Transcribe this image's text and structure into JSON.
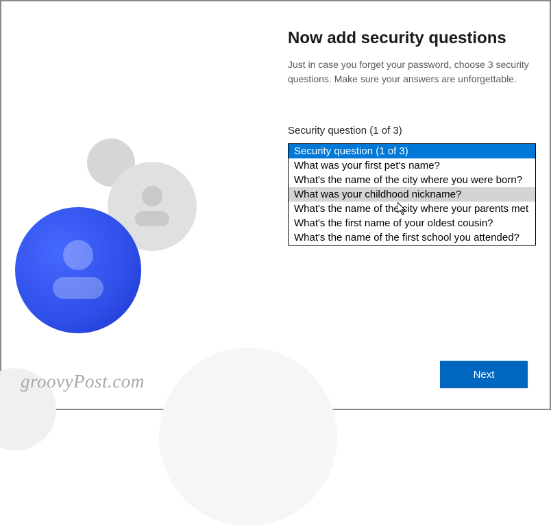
{
  "page": {
    "title": "Now add security questions",
    "subtitle": "Just in case you forget your password, choose 3 security questions. Make sure your answers are unforgettable.",
    "field_label": "Security question (1 of 3)"
  },
  "dropdown": {
    "options": [
      "Security question (1 of 3)",
      "What was your first pet's name?",
      "What's the name of the city where you were born?",
      "What was your childhood nickname?",
      "What's the name of the city where your parents met",
      "What's the first name of your oldest cousin?",
      "What's the name of the first school you attended?"
    ],
    "selected_index": 0,
    "hover_index": 3
  },
  "buttons": {
    "next": "Next"
  },
  "watermark": "groovyPost.com"
}
